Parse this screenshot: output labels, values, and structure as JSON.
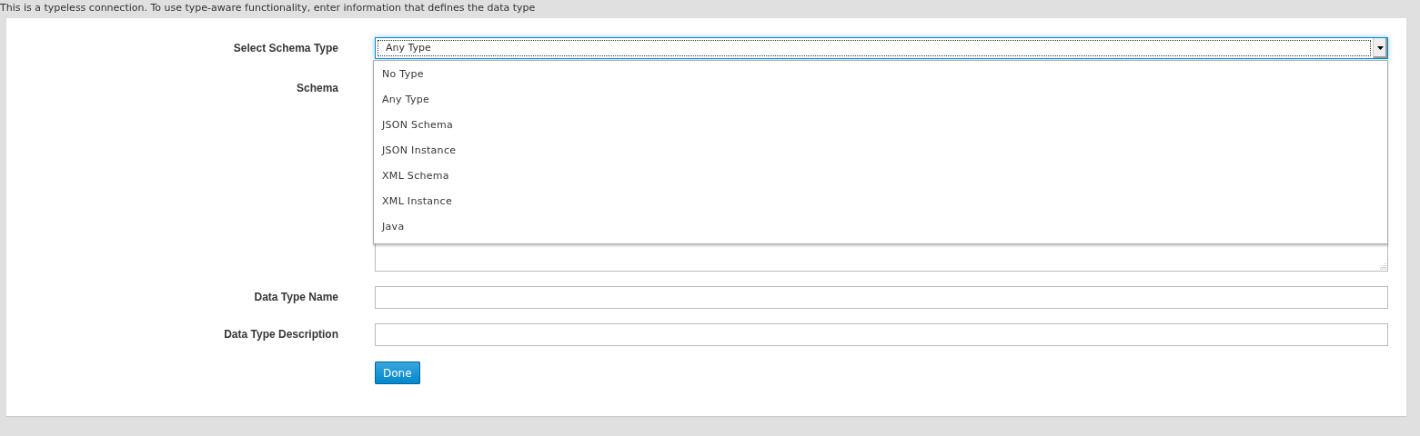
{
  "notice": "This is a typeless connection. To use type-aware functionality, enter information that defines the data type",
  "form": {
    "schema_type": {
      "label": "Select Schema Type",
      "value": "Any Type",
      "expanded": true,
      "options": [
        "No Type",
        "Any Type",
        "JSON Schema",
        "JSON Instance",
        "XML Schema",
        "XML Instance",
        "Java"
      ]
    },
    "schema": {
      "label": "Schema"
    },
    "data_type_name": {
      "label": "Data Type Name"
    },
    "data_type_description": {
      "label": "Data Type Description"
    },
    "done_button": "Done"
  }
}
